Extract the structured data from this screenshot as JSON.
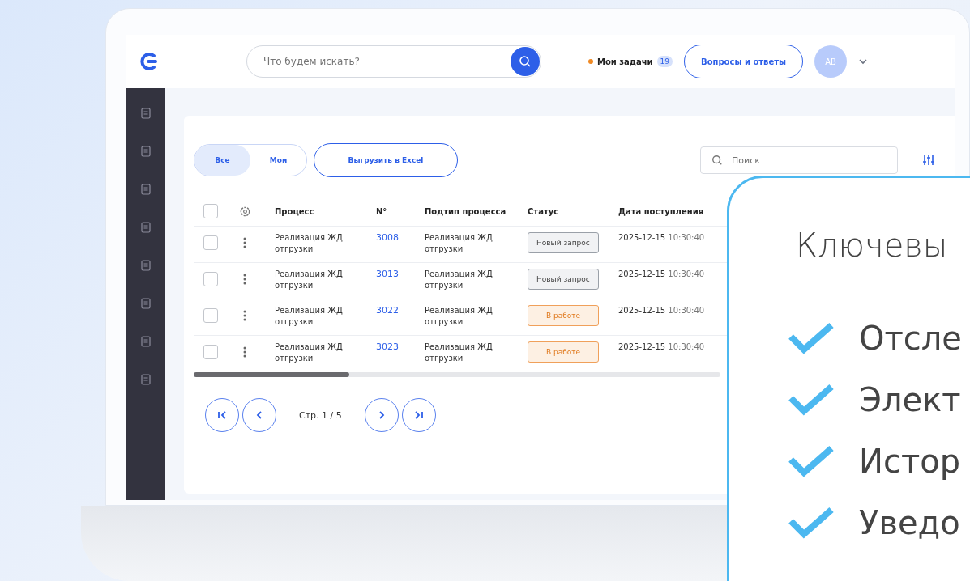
{
  "header": {
    "search": {
      "placeholder": "Что будем искать?"
    },
    "tasks": {
      "label": "Мои задачи",
      "count": "19"
    },
    "faq_button": "Вопросы и ответы",
    "avatar": "AB"
  },
  "toolbar": {
    "segments": [
      {
        "label": "Все",
        "selected": true
      },
      {
        "label": "Мои",
        "selected": false
      }
    ],
    "export_button": "Выгрузить в Excel",
    "search": {
      "placeholder": "Поиск"
    }
  },
  "table": {
    "select_all_checked": false,
    "columns": [
      "Процесс",
      "N°",
      "Подтип процесса",
      "Статус",
      "Дата поступления"
    ],
    "rows": [
      {
        "checked": false,
        "process": "Реализация ЖД отгрузки",
        "number": "3008",
        "subtype": "Реализация ЖД отгрузки",
        "status": {
          "kind": "new",
          "label": "Новый запрос"
        },
        "date": "2025-12-15",
        "time": "10:30:40"
      },
      {
        "checked": false,
        "process": "Реализация ЖД отгрузки",
        "number": "3013",
        "subtype": "Реализация ЖД отгрузки",
        "status": {
          "kind": "new",
          "label": "Новый запрос"
        },
        "date": "2025-12-15",
        "time": "10:30:40"
      },
      {
        "checked": false,
        "process": "Реализация ЖД отгрузки",
        "number": "3022",
        "subtype": "Реализация ЖД отгрузки",
        "status": {
          "kind": "progress",
          "label": "В работе"
        },
        "date": "2025-12-15",
        "time": "10:30:40"
      },
      {
        "checked": false,
        "process": "Реализация ЖД отгрузки",
        "number": "3023",
        "subtype": "Реализация ЖД отгрузки",
        "status": {
          "kind": "progress",
          "label": "В работе"
        },
        "date": "2025-12-15",
        "time": "10:30:40"
      }
    ]
  },
  "pagination": {
    "label": "Стр. 1 / 5"
  },
  "feature_card": {
    "title": "Ключевы",
    "items": [
      "Отсле",
      "Элект",
      "Истор",
      "Уведо"
    ]
  }
}
